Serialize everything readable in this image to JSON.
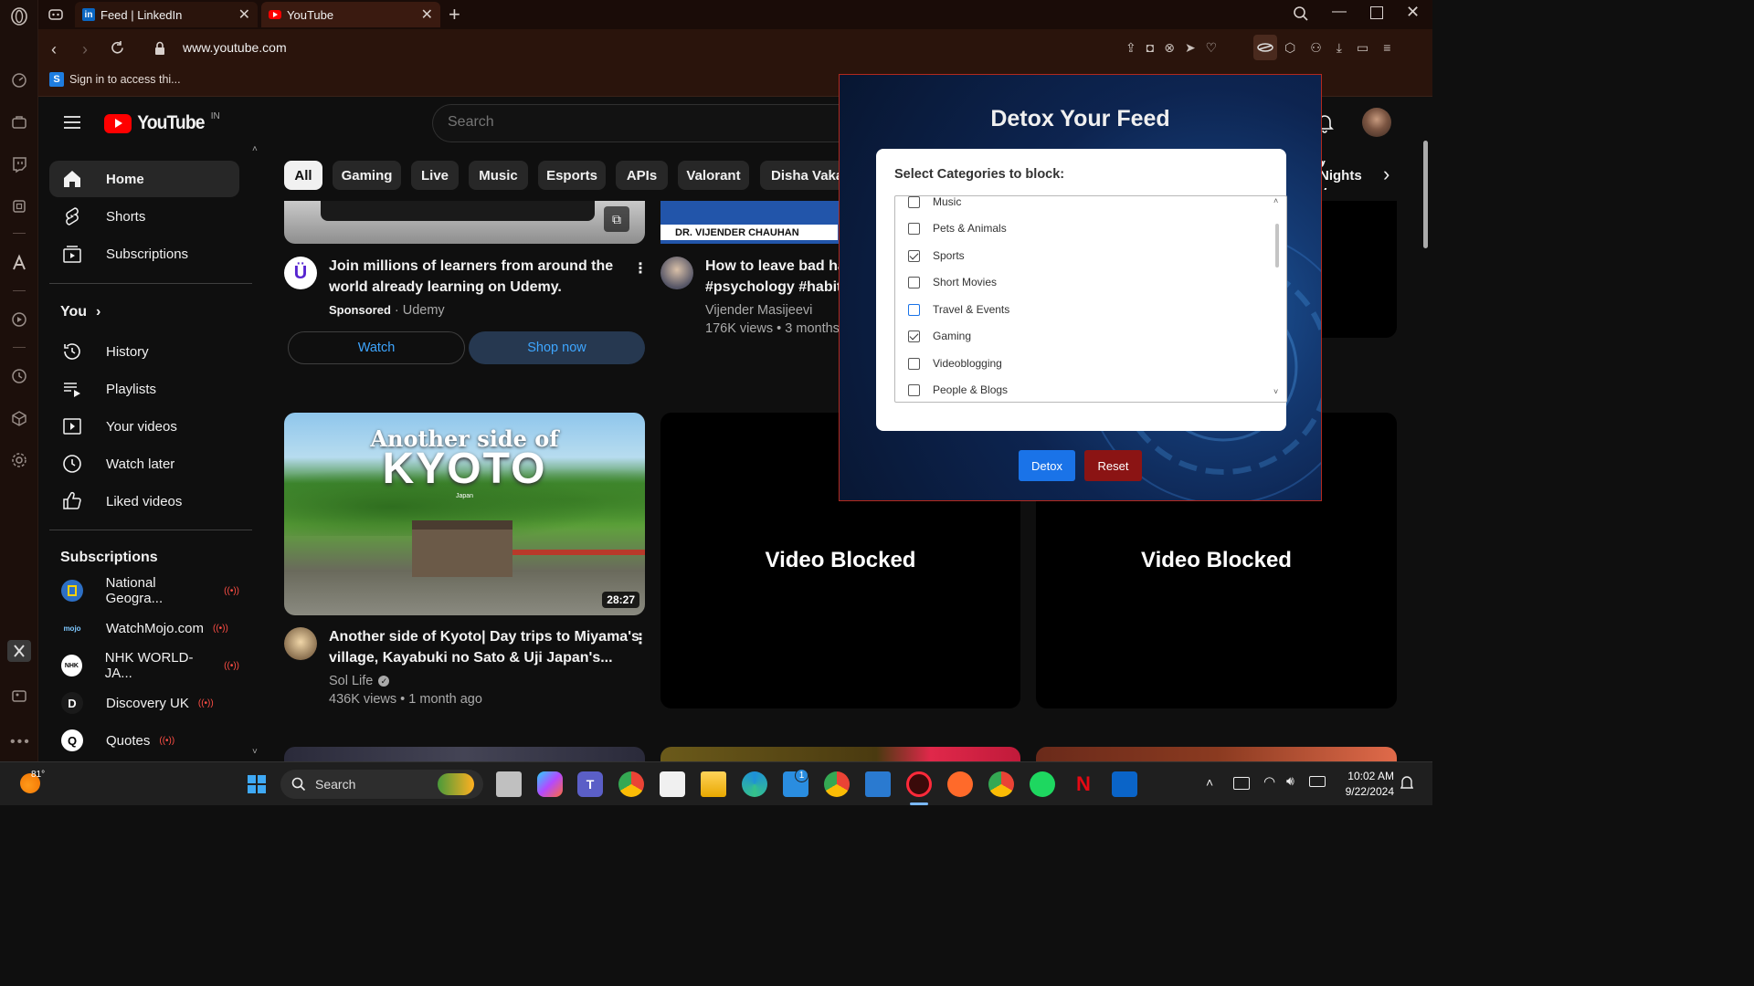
{
  "browser": {
    "tabs": [
      {
        "label": "Feed | LinkedIn",
        "icon": "linkedin-icon",
        "active": false
      },
      {
        "label": "YouTube",
        "icon": "youtube-icon",
        "active": true
      }
    ],
    "url": "www.youtube.com",
    "bookmark": "Sign in to access thi..."
  },
  "youtube": {
    "logo_text": "YouTube",
    "region": "IN",
    "search_placeholder": "Search",
    "sidebar": {
      "main": [
        "Home",
        "Shorts",
        "Subscriptions"
      ],
      "you_label": "You",
      "you_items": [
        "History",
        "Playlists",
        "Your videos",
        "Watch later",
        "Liked videos"
      ],
      "subs_header": "Subscriptions",
      "subscriptions": [
        "National Geogra...",
        "WatchMojo.com",
        "NHK WORLD-JA...",
        "Discovery UK",
        "Quotes"
      ]
    },
    "chips": [
      "All",
      "Gaming",
      "Live",
      "Music",
      "Esports",
      "APIs",
      "Valorant",
      "Disha Vakani",
      "y Nights v"
    ],
    "videos": {
      "ad": {
        "title_line1": "Join millions of learners from around the",
        "title_line2": "world already learning on Udemy.",
        "sponsored": "Sponsored",
        "advertiser": "Udemy",
        "watch_label": "Watch",
        "shop_label": "Shop now"
      },
      "v2": {
        "thumb_text": "DR. VIJENDER CHAUHAN",
        "title_line1": "How to leave bad ha",
        "title_line2": "#psychology #habits",
        "channel": "Vijender Masijeevi",
        "stats": "176K views • 3 months"
      },
      "kyoto": {
        "thumb_line1": "Another side of",
        "thumb_line2": "KYOTO",
        "thumb_small": "Japan",
        "duration": "28:27",
        "title_line1": "Another side of Kyoto| Day trips to Miyama's",
        "title_line2": "village, Kayabuki no Sato & Uji Japan's...",
        "channel": "Sol Life",
        "stats": "436K views • 1 month ago"
      },
      "blocked_label": "Video Blocked"
    }
  },
  "extension": {
    "title": "Detox Your Feed",
    "prompt": "Select Categories to block:",
    "categories": [
      {
        "label": "Music",
        "checked": false
      },
      {
        "label": "Pets & Animals",
        "checked": false
      },
      {
        "label": "Sports",
        "checked": true
      },
      {
        "label": "Short Movies",
        "checked": false
      },
      {
        "label": "Travel & Events",
        "checked": false
      },
      {
        "label": "Gaming",
        "checked": true
      },
      {
        "label": "Videoblogging",
        "checked": false
      },
      {
        "label": "People & Blogs",
        "checked": false
      }
    ],
    "detox_label": "Detox",
    "reset_label": "Reset"
  },
  "taskbar": {
    "weather": "81°",
    "search_label": "Search",
    "time": "10:02 AM",
    "date": "9/22/2024",
    "mail_badge": "1"
  },
  "colors": {
    "accent_blue": "#1a73e8",
    "reset_red": "#8b1414",
    "yt_red": "#ff0000"
  }
}
